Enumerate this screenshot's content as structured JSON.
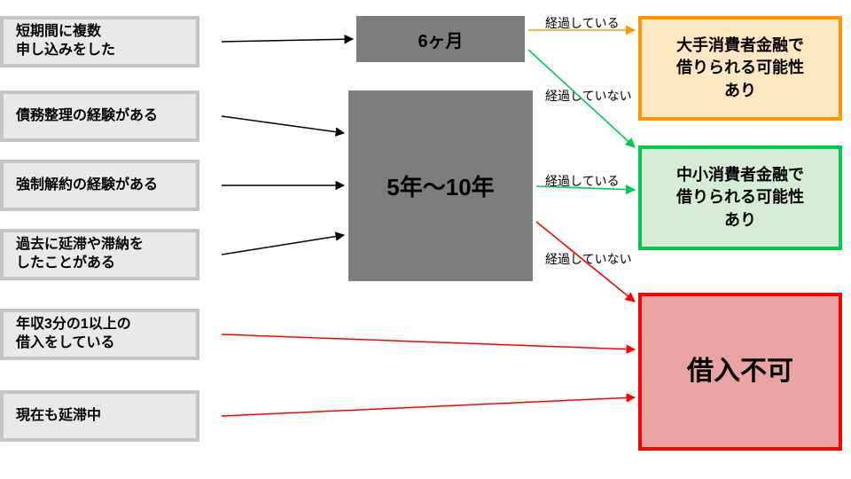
{
  "left": [
    "短期間に複数\n申し込みをした",
    "債務整理の経験がある",
    "強制解約の経験がある",
    "過去に延滞や滞納を\nしたことがある",
    "年収3分の1以上の\n借入をしている",
    "現在も延滞中"
  ],
  "mid": {
    "sixMonths": "6ヶ月",
    "fiveTen": "5年〜10年"
  },
  "out": {
    "major": "大手消費者金融で\n借りられる可能性\nあり",
    "minor": "中小消費者金融で\n借りられる可能性\nあり",
    "reject": "借入不可"
  },
  "labels": {
    "passed": "経過している",
    "notPassed": "経過していない"
  },
  "colors": {
    "orange": "#ff9800",
    "orangeFill": "#ffe7c2",
    "green": "#00c853",
    "greenFill": "#d7ecd7",
    "red": "#ff0000",
    "redFill": "#e9a3a3"
  }
}
